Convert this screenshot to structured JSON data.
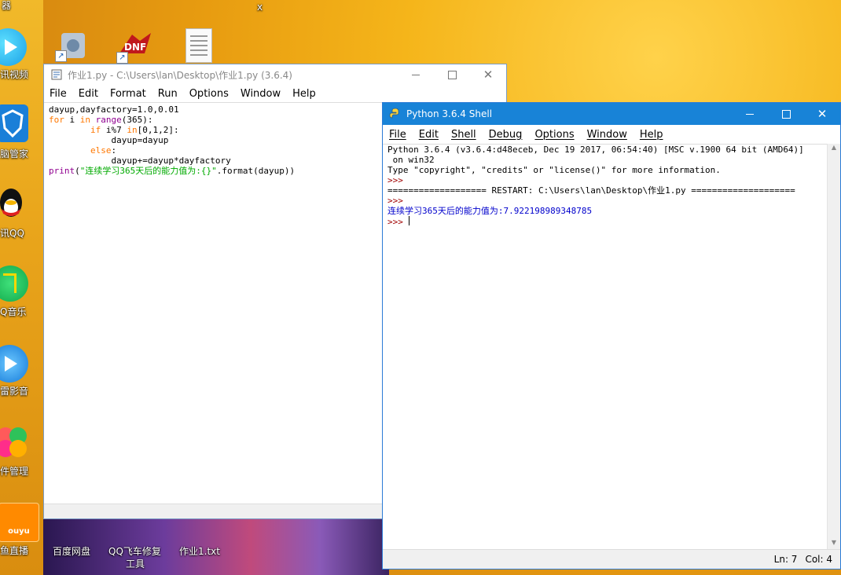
{
  "desktop": {
    "top_left_label": "器",
    "top_mark": "x",
    "icons": [
      {
        "label": "讯视频"
      },
      {
        "label": "脑管家"
      },
      {
        "label": "讯QQ"
      },
      {
        "label": "Q音乐"
      },
      {
        "label": "雷影音"
      },
      {
        "label": "件管理"
      },
      {
        "label": "鱼直播",
        "badge": "ouyu"
      },
      {
        "label": "百度网盘"
      },
      {
        "label": "QQ飞车修复工具",
        "label_line1": "QQ飞车修复",
        "label_line2": "工具"
      },
      {
        "label": "作业1.txt"
      }
    ]
  },
  "editor": {
    "title": "作业1.py - C:\\Users\\lan\\Desktop\\作业1.py (3.6.4)",
    "menu": [
      "File",
      "Edit",
      "Format",
      "Run",
      "Options",
      "Window",
      "Help"
    ],
    "code": {
      "line1": "dayup,dayfactory=1.0,0.01",
      "line2_kw": "for",
      "line2_a": " i ",
      "line2_kw2": "in",
      "line2_sp": " ",
      "line2_bi": "range",
      "line2_b": "(365):",
      "line3_indent": "        ",
      "line3_kw": "if",
      "line3_a": " i%7 ",
      "line3_kw2": "in",
      "line3_b": "[0,1,2]:",
      "line4": "            dayup=dayup",
      "line5_indent": "        ",
      "line5_kw": "else",
      "line5_b": ":",
      "line6": "            dayup+=dayup*dayfactory",
      "line7_bi": "print",
      "line7_a": "(",
      "line7_st": "\"连续学习365天后的能力值为:{}\"",
      "line7_b": ".format(dayup))"
    }
  },
  "shell": {
    "title": "Python 3.6.4 Shell",
    "menu": [
      "File",
      "Edit",
      "Shell",
      "Debug",
      "Options",
      "Window",
      "Help"
    ],
    "lines": {
      "l1": "Python 3.6.4 (v3.6.4:d48eceb, Dec 19 2017, 06:54:40) [MSC v.1900 64 bit (AMD64)]",
      "l2": " on win32",
      "l3": "Type \"copyright\", \"credits\" or \"license()\" for more information.",
      "prompt": ">>>",
      "restart": "=================== RESTART: C:\\Users\\lan\\Desktop\\作业1.py ====================",
      "output": "连续学习365天后的能力值为:7.922198989348785"
    },
    "status": {
      "ln": "Ln: 7",
      "col": "Col: 4"
    }
  },
  "colors": {
    "shell_title": "#1883d7",
    "keyword": "#ff7700",
    "builtin": "#900090",
    "string": "#00aa00",
    "output": "#0000cc",
    "prompt": "#a00000"
  }
}
